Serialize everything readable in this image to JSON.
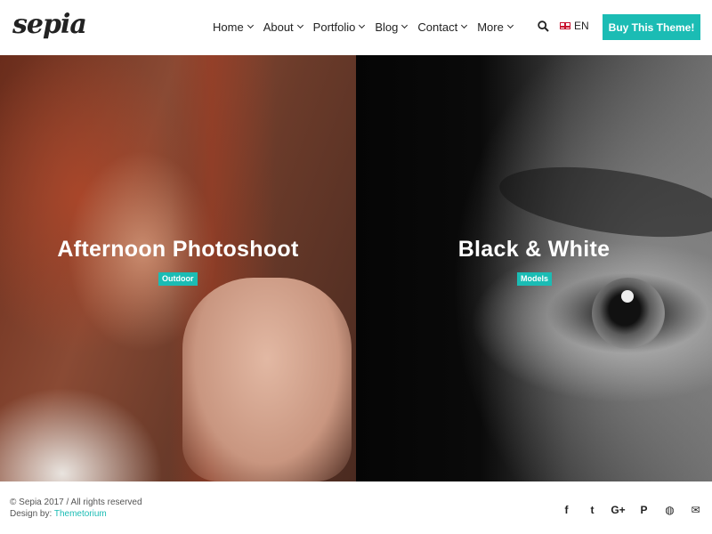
{
  "brand": {
    "logo": "sepia"
  },
  "nav": {
    "items": [
      {
        "label": "Home"
      },
      {
        "label": "About"
      },
      {
        "label": "Portfolio"
      },
      {
        "label": "Blog"
      },
      {
        "label": "Contact"
      },
      {
        "label": "More"
      }
    ],
    "search_icon": "search-icon",
    "language": {
      "flag": "uk-flag-icon",
      "label": "EN"
    },
    "cta_label": "Buy This Theme!"
  },
  "hero": {
    "panels": [
      {
        "title": "Afternoon Photoshoot",
        "tag": "Outdoor"
      },
      {
        "title": "Black & White",
        "tag": "Models"
      }
    ]
  },
  "footer": {
    "copyright": "© Sepia 2017 / All rights reserved",
    "design_prefix": "Design by: ",
    "design_link": "Themetorium",
    "social": [
      {
        "icon": "facebook-icon",
        "glyph": "f"
      },
      {
        "icon": "twitter-icon",
        "glyph": "t"
      },
      {
        "icon": "google-plus-icon",
        "glyph": "G+"
      },
      {
        "icon": "pinterest-icon",
        "glyph": "P"
      },
      {
        "icon": "dribbble-icon",
        "glyph": "◍"
      },
      {
        "icon": "email-icon",
        "glyph": "✉"
      }
    ]
  },
  "colors": {
    "accent": "#1bbcb4",
    "text": "#222222"
  }
}
